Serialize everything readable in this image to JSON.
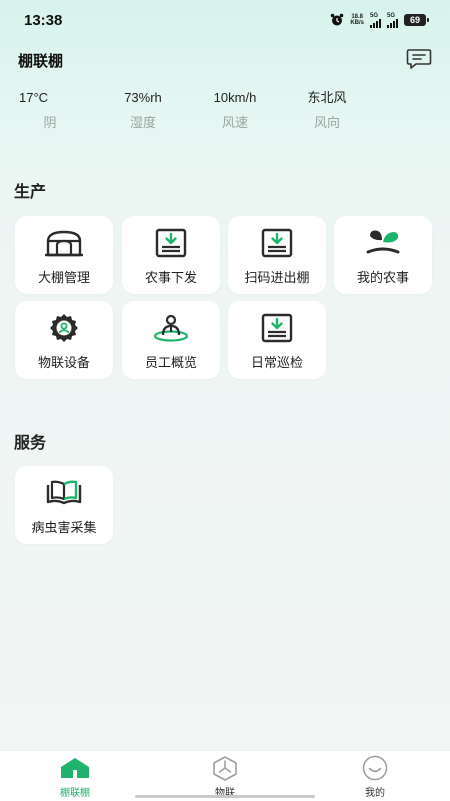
{
  "status_bar": {
    "time": "13:38",
    "net_speed_value": "18.8",
    "net_speed_unit": "KB/s",
    "sim1_label": "5G",
    "sim2_label": "5G",
    "battery": "69"
  },
  "header": {
    "title": "棚联棚",
    "message_icon": "chat-icon"
  },
  "weather": [
    {
      "value": "17°C",
      "label": "阴"
    },
    {
      "value": "73%rh",
      "label": "湿度"
    },
    {
      "value": "10km/h",
      "label": "风速"
    },
    {
      "value": "东北风",
      "label": "风向"
    }
  ],
  "production": {
    "title": "生产",
    "items": [
      {
        "label": "大棚管理",
        "icon": "greenhouse-icon"
      },
      {
        "label": "农事下发",
        "icon": "download-box-icon"
      },
      {
        "label": "扫码进出棚",
        "icon": "download-box-icon"
      },
      {
        "label": "我的农事",
        "icon": "sprout-icon"
      },
      {
        "label": "物联设备",
        "icon": "gear-icon"
      },
      {
        "label": "员工概览",
        "icon": "staff-icon"
      },
      {
        "label": "日常巡检",
        "icon": "download-box-icon"
      }
    ]
  },
  "service": {
    "title": "服务",
    "items": [
      {
        "label": "病虫害采集",
        "icon": "book-icon"
      }
    ]
  },
  "bottom_nav": [
    {
      "label": "棚联棚",
      "icon": "home-icon",
      "active": true
    },
    {
      "label": "物联",
      "icon": "iot-icon",
      "active": false
    },
    {
      "label": "我的",
      "icon": "smile-icon",
      "active": false
    }
  ],
  "colors": {
    "accent": "#1fb36b",
    "active_text": "#1fb36b",
    "inactive_text": "#333333",
    "icon_dark": "#2b2b2b"
  }
}
